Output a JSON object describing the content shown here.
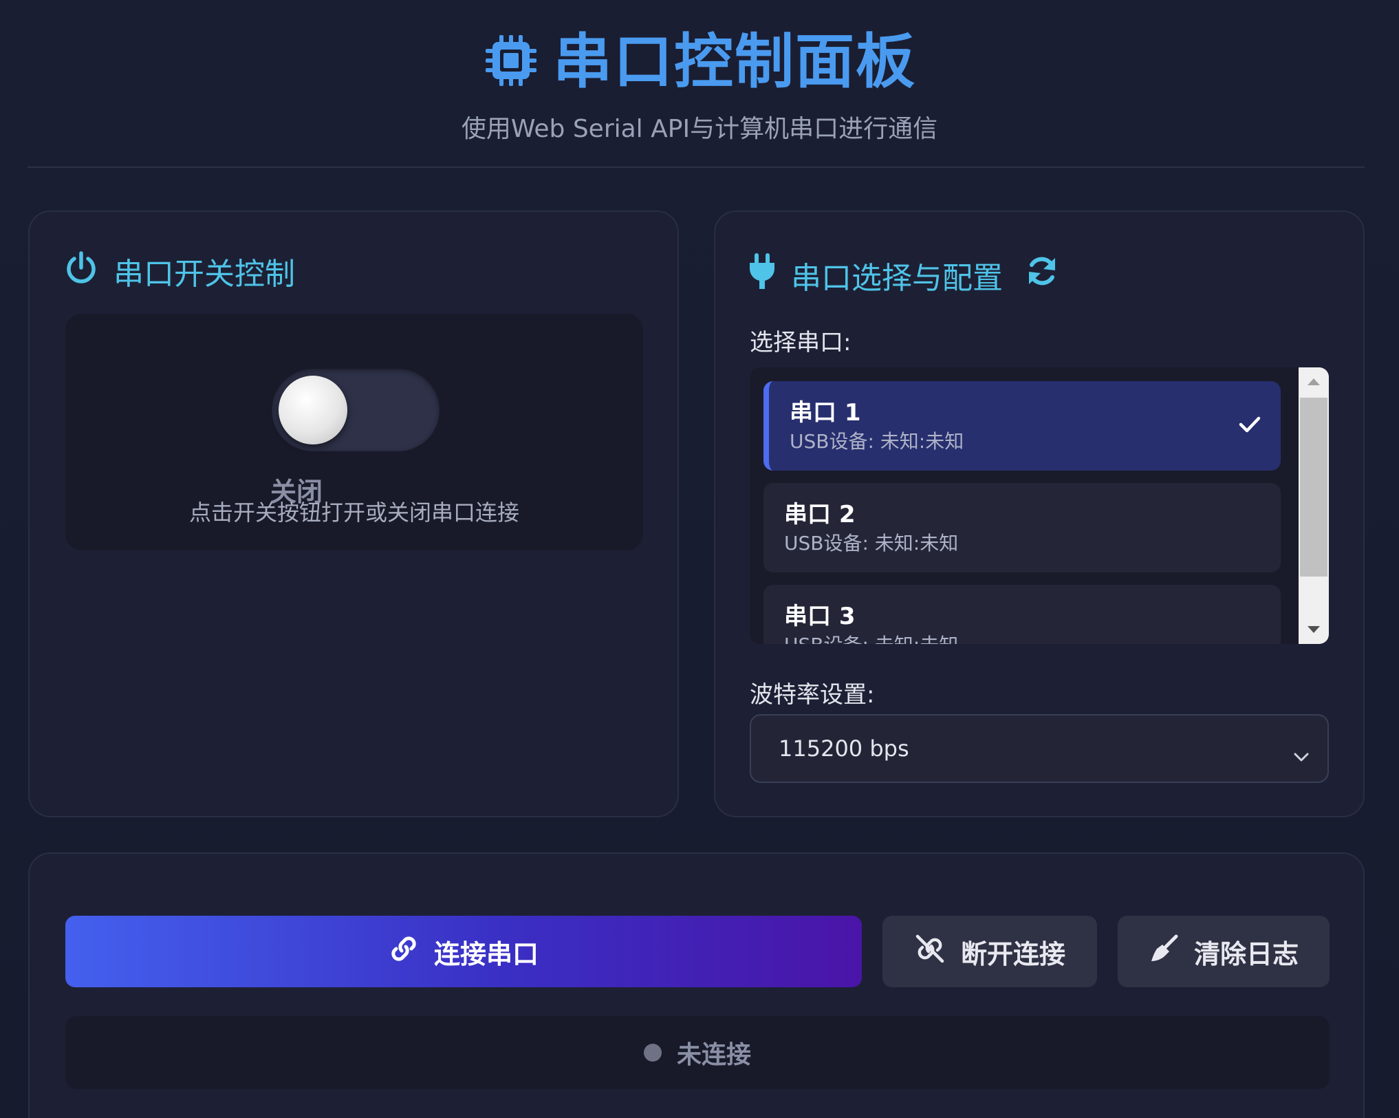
{
  "header": {
    "title": "串口控制面板",
    "subtitle": "使用Web Serial API与计算机串口进行通信"
  },
  "switch_card": {
    "title": "串口开关控制",
    "toggle_on": false,
    "state_label": "关闭",
    "hint": "点击开关按钮打开或关闭串口连接"
  },
  "port_card": {
    "title": "串口选择与配置",
    "select_port_label": "选择串口:",
    "ports": [
      {
        "name": "串口 1",
        "desc": "USB设备: 未知:未知",
        "selected": true
      },
      {
        "name": "串口 2",
        "desc": "USB设备: 未知:未知",
        "selected": false
      },
      {
        "name": "串口 3",
        "desc": "USB设备: 未知:未知",
        "selected": false
      }
    ],
    "baud_label": "波特率设置:",
    "baud_value": "115200 bps"
  },
  "actions": {
    "connect_label": "连接串口",
    "disconnect_label": "断开连接",
    "clear_label": "清除日志"
  },
  "status": {
    "text": "未连接"
  },
  "colors": {
    "accent_blue": "#4a9bf0",
    "accent_cyan": "#4fc3e8",
    "selected_port_bg": "#272f6e",
    "status_dot": "#6e7284"
  },
  "icons": {
    "title": "cpu-chip-icon",
    "switch_card": "power-icon",
    "port_card": "plug-icon",
    "refresh": "refresh-icon",
    "selected": "check-icon",
    "connect": "link-icon",
    "disconnect": "unlink-icon",
    "clear": "broom-icon"
  }
}
